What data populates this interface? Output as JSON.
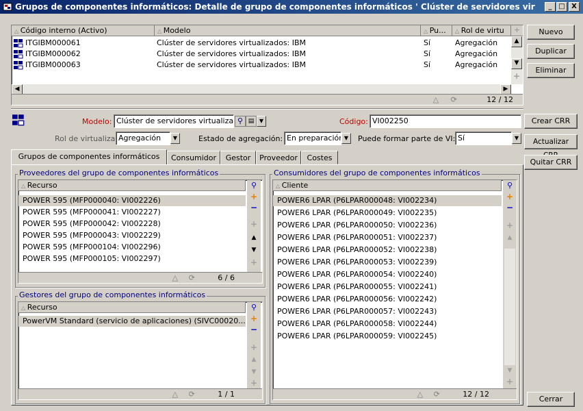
{
  "window": {
    "title": "Grupos de componentes informáticos: Detalle de grupo de componentes informáticos ' Clúster de servidores virtu...",
    "controls": [
      "_",
      "□",
      "X"
    ]
  },
  "top_table": {
    "headers": [
      "Código interno (Activo)",
      "Modelo",
      "Pu...",
      "Rol de virtu"
    ],
    "rows": [
      {
        "code": "ITGIBM000061",
        "model": "Clúster de servidores virtualizados: IBM",
        "pu": "Sí",
        "rol": "Agregación"
      },
      {
        "code": "ITGIBM000062",
        "model": "Clúster de servidores virtualizados: IBM",
        "pu": "Sí",
        "rol": "Agregación"
      },
      {
        "code": "ITGIBM000063",
        "model": "Clúster de servidores virtualizados: IBM",
        "pu": "Sí",
        "rol": "Agregación"
      }
    ],
    "count": "12 / 12"
  },
  "right_buttons": {
    "nuevo": "Nuevo",
    "duplicar": "Duplicar",
    "eliminar": "Eliminar",
    "crear_crr": "Crear CRR",
    "actualizar_crr": "Actualizar CRR",
    "quitar_crr": "Quitar CRR",
    "cerrar": "Cerrar"
  },
  "detail": {
    "modelo_label": "Modelo:",
    "modelo_value": "Clúster de servidores virtualiza",
    "codigo_label": "Código:",
    "codigo_value": "VI002250",
    "rol_label": "Rol de virtualización:",
    "rol_value": "Agregación",
    "estado_label": "Estado de agregación:",
    "estado_value": "En preparación",
    "puede_label": "Puede formar parte de VI:",
    "puede_value": "Sí"
  },
  "tabs": [
    "Grupos de componentes informáticos",
    "Consumidor",
    "Gestor",
    "Proveedor",
    "Costes"
  ],
  "proveedores": {
    "title": "Proveedores del grupo de componentes informáticos",
    "header": "Recurso",
    "rows": [
      "POWER 595 (MFP000040: VI002226)",
      "POWER 595 (MFP000041: VI002227)",
      "POWER 595 (MFP000042: VI002228)",
      "POWER 595 (MFP000043: VI002229)",
      "POWER 595 (MFP000104: VI002296)",
      "POWER 595 (MFP000105: VI002297)"
    ],
    "count": "6 / 6"
  },
  "gestores": {
    "title": "Gestores del grupo de componentes informáticos",
    "header": "Recurso",
    "rows": [
      "PowerVM Standard (servicio de aplicaciones) (SIVC00020..."
    ],
    "count": "1 / 1"
  },
  "consumidores": {
    "title": "Consumidores del grupo de componentes informáticos",
    "header": "Cliente",
    "rows": [
      "POWER6 LPAR (P6LPAR000048: VI002234)",
      "POWER6 LPAR (P6LPAR000049: VI002235)",
      "POWER6 LPAR (P6LPAR000050: VI002236)",
      "POWER6 LPAR (P6LPAR000051: VI002237)",
      "POWER6 LPAR (P6LPAR000052: VI002238)",
      "POWER6 LPAR (P6LPAR000053: VI002239)",
      "POWER6 LPAR (P6LPAR000054: VI002240)",
      "POWER6 LPAR (P6LPAR000055: VI002241)",
      "POWER6 LPAR (P6LPAR000056: VI002242)",
      "POWER6 LPAR (P6LPAR000057: VI002243)",
      "POWER6 LPAR (P6LPAR000058: VI002244)",
      "POWER6 LPAR (P6LPAR000059: VI002245)"
    ],
    "count": "12 / 12"
  },
  "colors": {
    "titlebar": "#0a246a",
    "required_label": "#c00000",
    "groupbox_title": "#000080",
    "add_icon": "#e08000",
    "remove_icon": "#0000c0"
  }
}
